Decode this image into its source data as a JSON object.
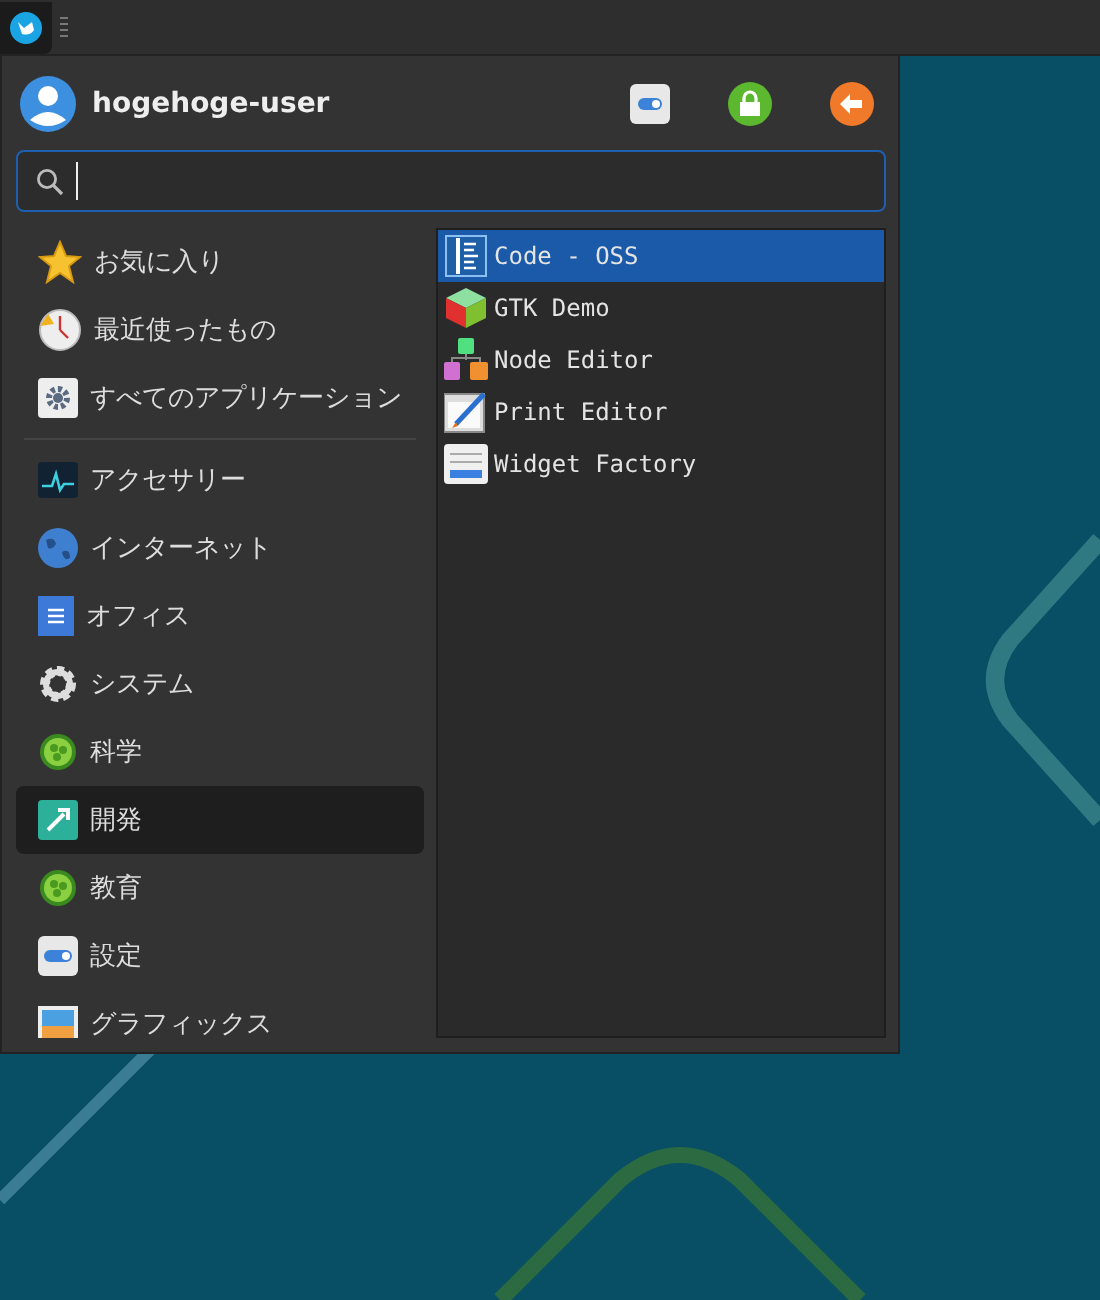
{
  "user": {
    "name": "hogehoge-user"
  },
  "places": [
    {
      "label": "お気に入り",
      "selected": false
    },
    {
      "label": "最近使ったもの",
      "selected": false
    },
    {
      "label": "すべてのアプリケーション",
      "selected": false
    }
  ],
  "categories": [
    {
      "label": "アクセサリー",
      "selected": false
    },
    {
      "label": "インターネット",
      "selected": false
    },
    {
      "label": "オフィス",
      "selected": false
    },
    {
      "label": "システム",
      "selected": false
    },
    {
      "label": "科学",
      "selected": false
    },
    {
      "label": "開発",
      "selected": true
    },
    {
      "label": "教育",
      "selected": false
    },
    {
      "label": "設定",
      "selected": false
    },
    {
      "label": "グラフィックス",
      "selected": false
    }
  ],
  "apps": [
    {
      "label": "Code - OSS",
      "selected": true
    },
    {
      "label": "GTK Demo",
      "selected": false
    },
    {
      "label": "Node Editor",
      "selected": false
    },
    {
      "label": "Print Editor",
      "selected": false
    },
    {
      "label": "Widget Factory",
      "selected": false
    }
  ]
}
